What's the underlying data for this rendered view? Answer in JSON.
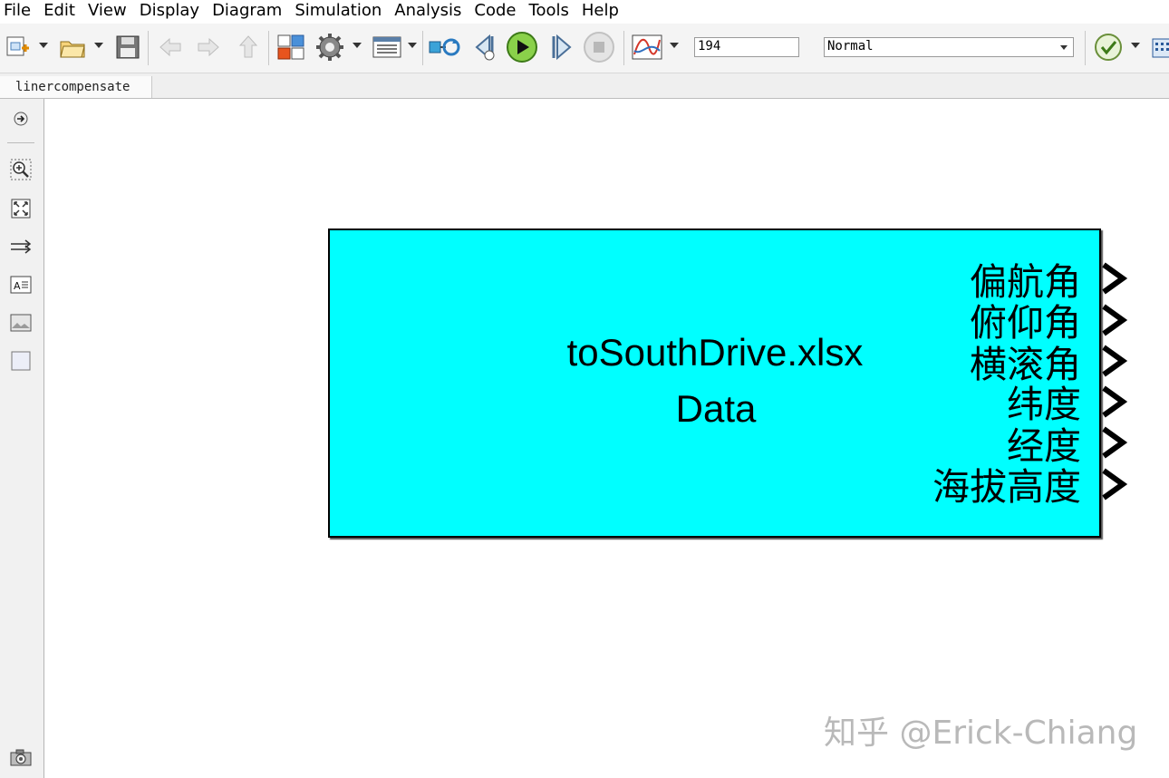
{
  "menu": [
    "File",
    "Edit",
    "View",
    "Display",
    "Diagram",
    "Simulation",
    "Analysis",
    "Code",
    "Tools",
    "Help"
  ],
  "toolbar": {
    "stop_time": "194",
    "sim_mode": "Normal",
    "icons": [
      "new-model-icon",
      "open-folder-icon",
      "save-icon",
      "back-icon",
      "forward-icon",
      "up-icon",
      "library-browser-icon",
      "model-settings-icon",
      "model-explorer-icon",
      "update-diagram-icon",
      "step-back-icon",
      "run-icon",
      "step-forward-icon",
      "stop-icon",
      "scope-icon",
      "check-model-icon",
      "grid-icon"
    ]
  },
  "tab": {
    "model_name": "linercompensate"
  },
  "palette": [
    "hide-show-icon",
    "zoom-icon",
    "fit-to-view-icon",
    "route-lines-icon",
    "annotation-icon",
    "image-icon",
    "area-icon",
    "camera-icon"
  ],
  "block": {
    "file": "toSouthDrive.xlsx",
    "name": "Data",
    "color": "#00ffff",
    "ports": [
      "偏航角",
      "俯仰角",
      "横滚角",
      "纬度",
      "经度",
      "海拔高度"
    ]
  },
  "watermark": "知乎 @Erick-Chiang"
}
